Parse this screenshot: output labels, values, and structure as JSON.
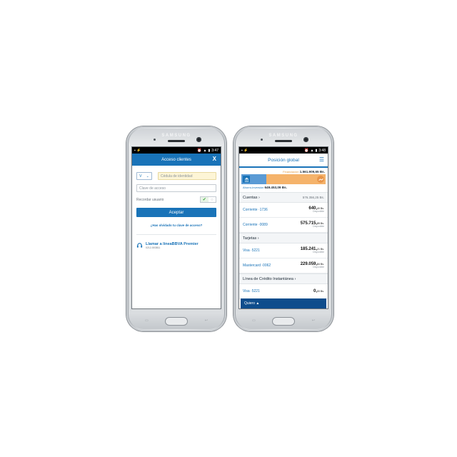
{
  "colors": {
    "brand_blue": "#1973b8",
    "dark_blue": "#0e4d8c",
    "orange": "#f5b36b",
    "light_blue": "#5b9bd5"
  },
  "phone_brand": "SAMSUNG",
  "left": {
    "status_time": "3:47",
    "header_title": "Acceso clientes",
    "close_label": "X",
    "id_type": "V",
    "id_placeholder": "Cédula de identidad",
    "password_placeholder": "Clave de acceso",
    "remember_label": "Recordar usuario",
    "toggle_on": "✔",
    "toggle_off": "○",
    "accept_label": "Aceptar",
    "forgot_link": "¿Has olvidado tu clave de acceso?",
    "call_title": "Llamar a lineaBBVA Premier",
    "call_number": "0212-503811"
  },
  "right": {
    "status_time": "3:48",
    "header_title": "Posición global",
    "financing_label": "Financiación",
    "financing_value": "1.561.909,65 Bs.",
    "savings_label": "Ahorro-inversión",
    "savings_value": "649.453,09 Bs.",
    "financing_share": 0.7,
    "accounts": {
      "title": "Cuentas",
      "total": "576.356,25 Bs.",
      "items": [
        {
          "name": "Corriente ·1736",
          "amount": "640,",
          "decimals": "40 Bs.",
          "sub": "Disponible"
        },
        {
          "name": "Corriente ·0089",
          "amount": "575.715,",
          "decimals": "85 Bs.",
          "sub": "Disponible"
        }
      ]
    },
    "cards": {
      "title": "Tarjetas",
      "items": [
        {
          "name": "Visa ·5221",
          "amount": "185.241,",
          "decimals": "21 Bs.",
          "sub": "Disponible"
        },
        {
          "name": "Mastercard ·0062",
          "amount": "229.059,",
          "decimals": "84 Bs.",
          "sub": "Disponible"
        }
      ]
    },
    "credit_line": {
      "title": "Línea de Crédito Instantánea",
      "items": [
        {
          "name": "Visa ·5221",
          "amount": "0,",
          "decimals": "00 Bs."
        }
      ]
    },
    "quiero_label": "Quiero"
  }
}
